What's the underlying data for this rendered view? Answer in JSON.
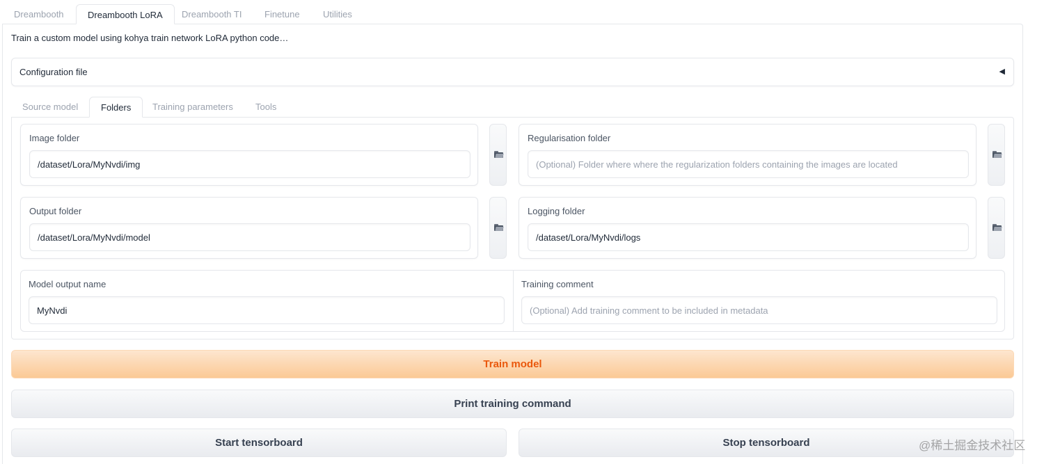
{
  "top_tabs": [
    {
      "label": "Dreambooth",
      "active": false
    },
    {
      "label": "Dreambooth LoRA",
      "active": true
    },
    {
      "label": "Dreambooth TI",
      "active": false
    },
    {
      "label": "Finetune",
      "active": false
    },
    {
      "label": "Utilities",
      "active": false
    }
  ],
  "description": "Train a custom model using kohya train network LoRA python code…",
  "config_accordion": {
    "label": "Configuration file",
    "caret": "◀"
  },
  "inner_tabs": [
    {
      "label": "Source model",
      "active": false
    },
    {
      "label": "Folders",
      "active": true
    },
    {
      "label": "Training parameters",
      "active": false
    },
    {
      "label": "Tools",
      "active": false
    }
  ],
  "folders": {
    "image_folder": {
      "label": "Image folder",
      "value": "/dataset/Lora/MyNvdi/img",
      "placeholder": ""
    },
    "regularisation_folder": {
      "label": "Regularisation folder",
      "value": "",
      "placeholder": "(Optional) Folder where where the regularization folders containing the images are located"
    },
    "output_folder": {
      "label": "Output folder",
      "value": "/dataset/Lora/MyNvdi/model",
      "placeholder": ""
    },
    "logging_folder": {
      "label": "Logging folder",
      "value": "/dataset/Lora/MyNvdi/logs",
      "placeholder": ""
    },
    "model_output_name": {
      "label": "Model output name",
      "value": "MyNvdi",
      "placeholder": ""
    },
    "training_comment": {
      "label": "Training comment",
      "value": "",
      "placeholder": "(Optional) Add training comment to be included in metadata"
    }
  },
  "buttons": {
    "train": "Train model",
    "print": "Print training command",
    "start_tensorboard": "Start tensorboard",
    "stop_tensorboard": "Stop tensorboard"
  },
  "watermark": "@稀土掘金技术社区",
  "colors": {
    "accent": "#ea580c",
    "border": "#e5e7eb",
    "muted_text": "#9ca3af"
  }
}
